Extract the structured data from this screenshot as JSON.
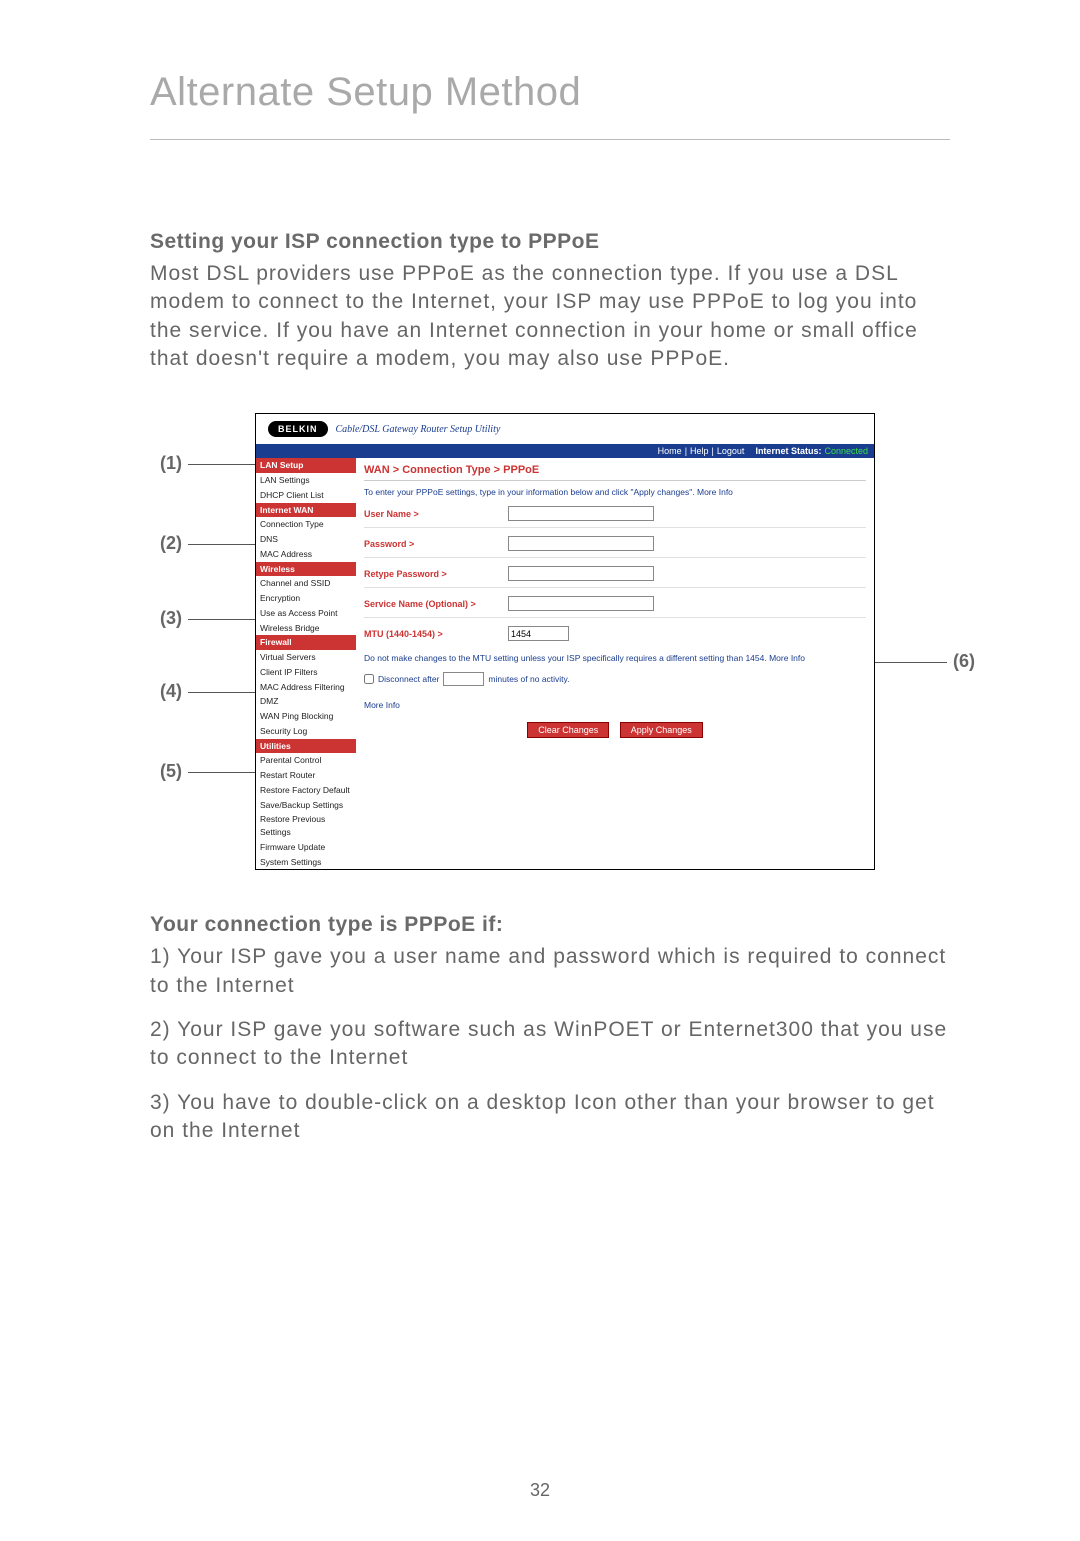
{
  "page_title": "Alternate Setup Method",
  "page_number": "32",
  "section1": {
    "heading": "Setting your ISP connection type to PPPoE",
    "body": "Most DSL providers use PPPoE as the connection type. If you use a DSL modem to connect to the Internet, your ISP may use PPPoE to log you into the service. If you have an Internet connection in your home or small office that doesn't require a modem, you may also use PPPoE."
  },
  "section2": {
    "heading": "Your connection type is PPPoE if:",
    "items": [
      "1) Your ISP gave you a user name and password which is required to connect to the Internet",
      "2) Your ISP gave you software such as WinPOET or Enternet300 that you use to connect to the Internet",
      "3) You have to double-click on a desktop Icon other than your browser to get on the Internet"
    ]
  },
  "callouts": [
    "(1)",
    "(2)",
    "(3)",
    "(4)",
    "(5)",
    "(6)"
  ],
  "screenshot": {
    "brand": "BELKIN",
    "utility": "Cable/DSL Gateway Router Setup Utility",
    "header_links": [
      "Home",
      "Help",
      "Logout"
    ],
    "status_label": "Internet Status:",
    "status_value": "Connected",
    "sidebar": {
      "groups": [
        {
          "cat": "LAN Setup",
          "items": [
            "LAN Settings",
            "DHCP Client List"
          ]
        },
        {
          "cat": "Internet WAN",
          "items": [
            "Connection Type",
            "DNS",
            "MAC Address"
          ]
        },
        {
          "cat": "Wireless",
          "items": [
            "Channel and SSID",
            "Encryption",
            "Use as Access Point",
            "Wireless Bridge"
          ]
        },
        {
          "cat": "Firewall",
          "items": [
            "Virtual Servers",
            "Client IP Filters",
            "MAC Address Filtering",
            "DMZ",
            "WAN Ping Blocking",
            "Security Log"
          ]
        },
        {
          "cat": "Utilities",
          "items": [
            "Parental Control",
            "Restart Router",
            "Restore Factory Default",
            "Save/Backup Settings",
            "Restore Previous Settings",
            "Firmware Update",
            "System Settings"
          ]
        }
      ]
    },
    "panel": {
      "breadcrumb": "WAN > Connection Type > PPPoE",
      "instruction": "To enter your PPPoE settings, type in your information below and click \"Apply changes\".",
      "more_info": "More Info",
      "fields": {
        "username": "User Name >",
        "password": "Password >",
        "retype": "Retype Password >",
        "service": "Service Name (Optional) >",
        "mtu": "MTU (1440-1454) >",
        "mtu_value": "1454",
        "mtu_note": "Do not make changes to the MTU setting unless your ISP specifically requires a different setting than 1454.",
        "disconnect_pre": "Disconnect after",
        "disconnect_post": "minutes of no activity."
      },
      "buttons": {
        "clear": "Clear Changes",
        "apply": "Apply Changes"
      }
    }
  }
}
